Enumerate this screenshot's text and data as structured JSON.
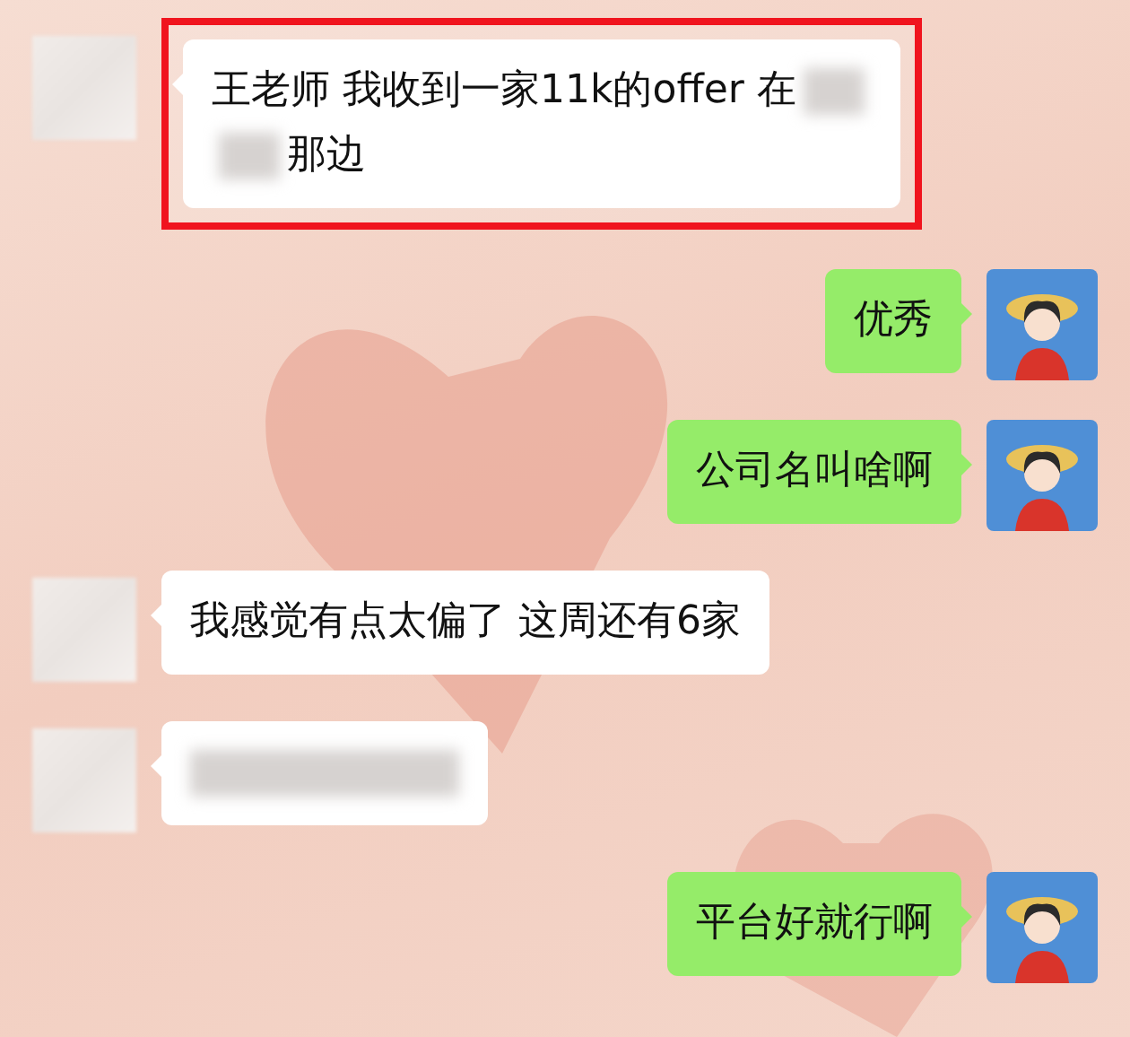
{
  "messages": [
    {
      "kind": "incoming",
      "highlighted": true,
      "lines": [
        [
          {
            "kind": "text",
            "text": "王老师 我收到一家11k的offer 在"
          },
          {
            "kind": "redacted"
          }
        ],
        [
          {
            "kind": "redacted"
          },
          {
            "kind": "text",
            "text": "那边"
          }
        ]
      ]
    },
    {
      "kind": "outgoing",
      "highlighted": false,
      "lines": [
        [
          {
            "kind": "text",
            "text": "优秀"
          }
        ]
      ]
    },
    {
      "kind": "outgoing",
      "highlighted": false,
      "lines": [
        [
          {
            "kind": "text",
            "text": "公司名叫啥啊"
          }
        ]
      ]
    },
    {
      "kind": "incoming",
      "highlighted": false,
      "lines": [
        [
          {
            "kind": "text",
            "text": "我感觉有点太偏了 这周还有6家"
          }
        ]
      ]
    },
    {
      "kind": "incoming",
      "highlighted": false,
      "lines": [
        [
          {
            "kind": "redacted-line"
          }
        ]
      ]
    },
    {
      "kind": "outgoing",
      "highlighted": false,
      "lines": [
        [
          {
            "kind": "text",
            "text": "平台好就行啊"
          }
        ]
      ]
    }
  ]
}
